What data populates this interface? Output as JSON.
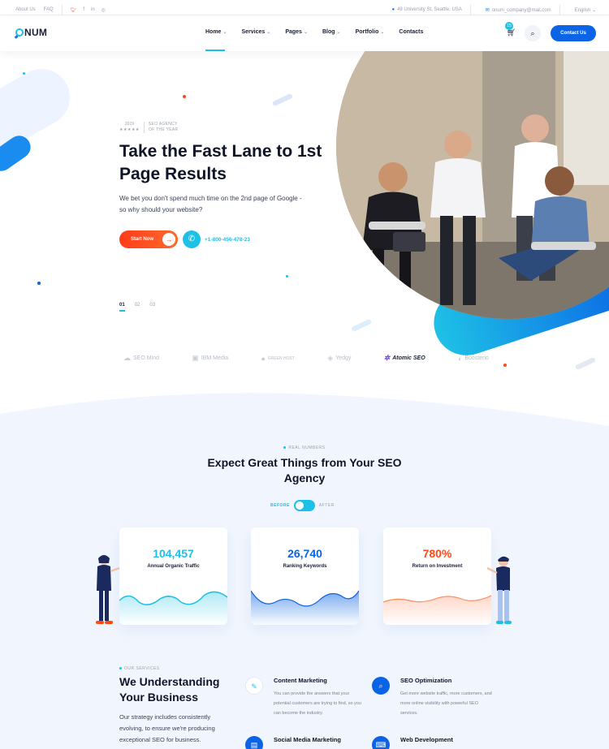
{
  "topbar": {
    "links": [
      "About Us",
      "FAQ"
    ],
    "address": "49 University St, Seattle, USA",
    "email": "onum_company@mail.com",
    "language": "English"
  },
  "header": {
    "logo": "NUM",
    "nav": [
      {
        "label": "Home",
        "has_dropdown": true,
        "active": true
      },
      {
        "label": "Services",
        "has_dropdown": true
      },
      {
        "label": "Pages",
        "has_dropdown": true
      },
      {
        "label": "Blog",
        "has_dropdown": true
      },
      {
        "label": "Portfolio",
        "has_dropdown": true
      },
      {
        "label": "Contacts",
        "has_dropdown": false
      }
    ],
    "cart_count": "15",
    "contact_button": "Contact Us"
  },
  "hero": {
    "badge_year": "2019",
    "badge_stars": "★★★★★",
    "badge_line1": "SEO AGENCY",
    "badge_line2": "OF THE YEAR",
    "title": "Take the Fast Lane to 1st Page Results",
    "description": "We bet you don't spend much time on the 2nd page of Google - so why should your website?",
    "start_button": "Start Now",
    "phone": "+1-800-456-478-23",
    "slides": [
      "01",
      "02",
      "03"
    ],
    "active_slide": 0
  },
  "brands": [
    {
      "name": "SEO Mind",
      "icon": "cloud-logo-icon"
    },
    {
      "name": "IBM Media",
      "icon": "square-logo-icon"
    },
    {
      "name": "GREEN HOST",
      "icon": "blob-logo-icon"
    },
    {
      "name": "Yedgy",
      "icon": "diamond-logo-icon"
    },
    {
      "name": "Atomic SEO",
      "icon": "atom-logo-icon",
      "highlighted": true
    },
    {
      "name": "Boosterio",
      "icon": "circle-logo-icon"
    }
  ],
  "stats": {
    "eyebrow": "REAL NUMBERS",
    "title": "Expect Great Things from Your SEO Agency",
    "toggle_before": "BEFORE",
    "toggle_after": "AFTER",
    "cards": [
      {
        "value": "104,457",
        "label": "Annual Organic Traffic",
        "color": "#1ec1e6"
      },
      {
        "value": "26,740",
        "label": "Ranking Keywords",
        "color": "#0b63e5"
      },
      {
        "value": "780%",
        "label": "Return on Investment",
        "color": "#ff4a17"
      }
    ]
  },
  "services": {
    "eyebrow": "OUR SERVICES",
    "title": "We Understanding Your Business",
    "description": "Our strategy includes consistently evolving, to ensure we're producing exceptional SEO for business.",
    "items": [
      {
        "name": "Content Marketing",
        "desc": "You can provide the answers that your potential customers are trying to find, so you can become the industry.",
        "icon": "content-marketing-icon",
        "color": "#1ec1e6"
      },
      {
        "name": "SEO Optimization",
        "desc": "Get more website traffic, more customers, and more online visibility with powerful SEO services.",
        "icon": "seo-magnifier-icon",
        "color": "#0b63e5"
      },
      {
        "name": "Social Media Marketing",
        "desc": "",
        "icon": "social-media-icon",
        "color": "#0b63e5"
      },
      {
        "name": "Web Development",
        "desc": "",
        "icon": "web-development-icon",
        "color": "#0b63e5"
      }
    ]
  }
}
